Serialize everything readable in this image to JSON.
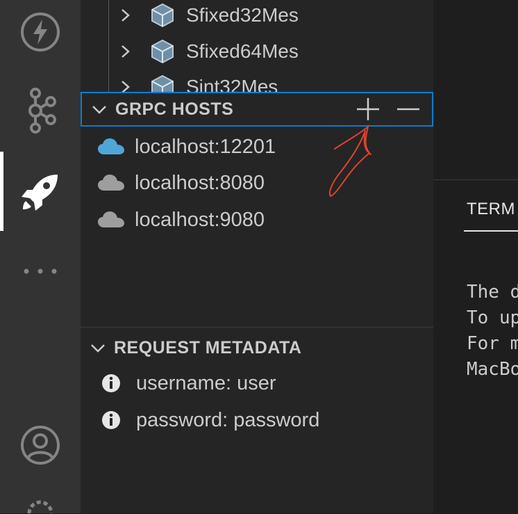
{
  "tree": {
    "items": [
      {
        "label": "Sfixed32Mes"
      },
      {
        "label": "Sfixed64Mes"
      },
      {
        "label": "Sint32Mes"
      }
    ]
  },
  "grpc_hosts": {
    "title": "GRPC HOSTS",
    "hosts": [
      {
        "label": "localhost:12201",
        "active": true
      },
      {
        "label": "localhost:8080",
        "active": false
      },
      {
        "label": "localhost:9080",
        "active": false
      }
    ]
  },
  "request_metadata": {
    "title": "REQUEST METADATA",
    "items": [
      {
        "label": "username: user"
      },
      {
        "label": "password: password"
      }
    ]
  },
  "panel": {
    "tab": "TERM",
    "lines": [
      "The d",
      "To up",
      "For m",
      "MacBo"
    ]
  },
  "colors": {
    "accent": "#007fd4",
    "active_cloud": "#4fa6d6",
    "inactive_cloud": "#9e9e9e",
    "annotation": "#e0442a"
  }
}
